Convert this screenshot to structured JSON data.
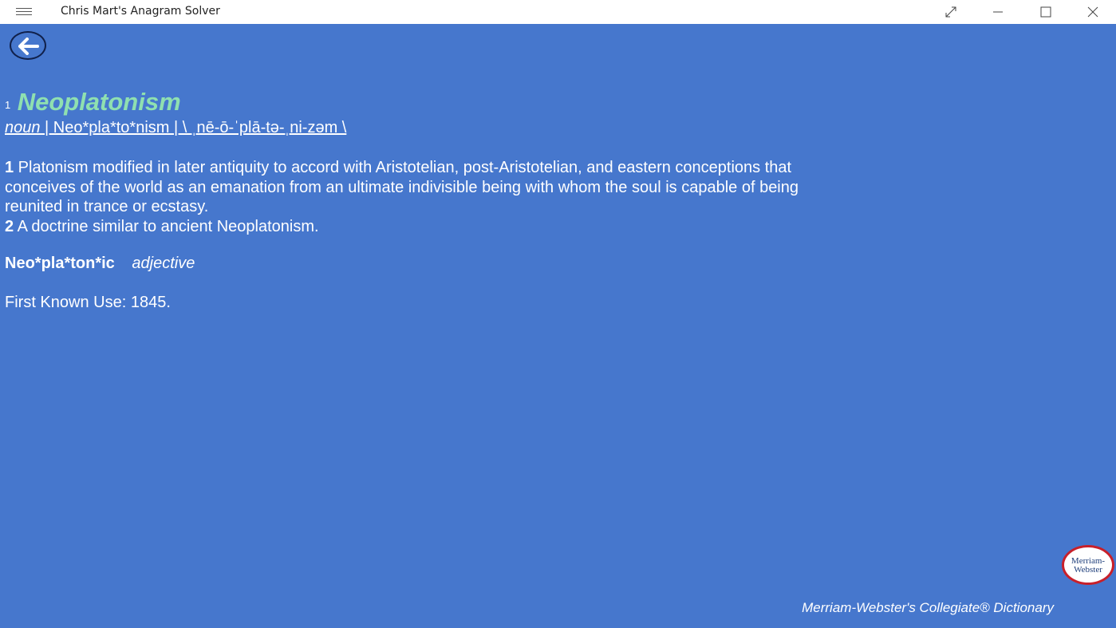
{
  "window": {
    "title": "Chris Mart's Anagram Solver"
  },
  "entry": {
    "homograph": "1",
    "headword": "Neoplatonism",
    "part_of_speech": "noun",
    "syllabification": " | Neo*pla*to*nism | \\ ˌnē-ō-ˈplā-tə-ˌni-zəm \\",
    "definitions": [
      {
        "num": "1",
        "text": " Platonism modified in later antiquity to accord with Aristotelian, post-Aristotelian, and eastern conceptions that conceives of the world as an emanation from an ultimate indivisible being with whom the soul is capable of being reunited in trance or ecstasy."
      },
      {
        "num": "2",
        "text": " A doctrine similar to ancient Neoplatonism."
      }
    ],
    "derived_word": "Neo*pla*ton*ic",
    "derived_pos": "adjective",
    "first_known_use": "First Known Use: 1845."
  },
  "footer": {
    "credit": "Merriam-Webster's Collegiate® Dictionary",
    "logo_line1": "Merriam-",
    "logo_line2": "Webster"
  },
  "colors": {
    "background": "#4677cd",
    "headword": "#8fe0b0",
    "text": "#ffffff"
  },
  "icons": {
    "menu": "hamburger-icon",
    "back": "back-arrow-icon",
    "fullscreen": "expand-icon",
    "minimize": "minimize-icon",
    "maximize": "maximize-icon",
    "close": "close-icon"
  }
}
